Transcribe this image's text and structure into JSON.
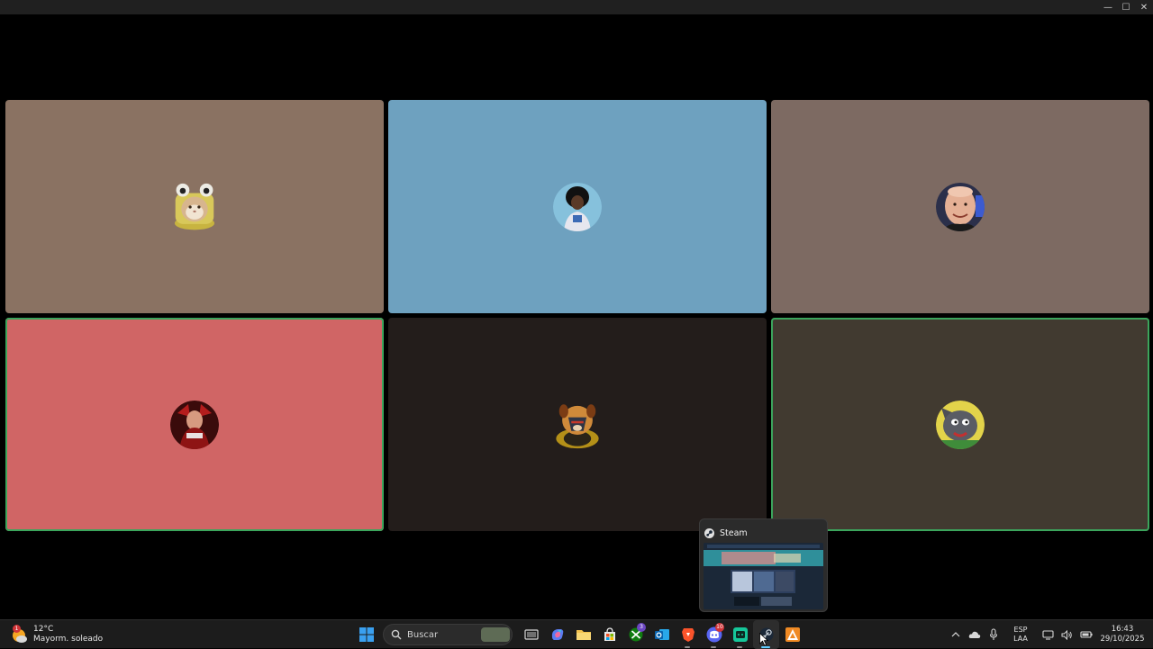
{
  "window": {
    "controls": {
      "minimize": "—",
      "maximize": "☐",
      "close": "✕"
    }
  },
  "tiles": [
    {
      "id": "user-1",
      "bg": "#8a7262",
      "speaking": false,
      "avatar": "frog-hat-cat"
    },
    {
      "id": "user-2",
      "bg": "#6ea1bf",
      "speaking": false,
      "avatar": "afro-player"
    },
    {
      "id": "user-3",
      "bg": "#7d6a62",
      "speaking": false,
      "avatar": "bald-man"
    },
    {
      "id": "user-4",
      "bg": "#d06565",
      "speaking": true,
      "avatar": "red-warrior"
    },
    {
      "id": "user-5",
      "bg": "#231d1b",
      "speaking": false,
      "avatar": "dog-knight"
    },
    {
      "id": "user-6",
      "bg": "#413a30",
      "speaking": true,
      "avatar": "grey-cat-cartoon"
    }
  ],
  "taskbar": {
    "weather": {
      "temp": "12°C",
      "condition": "Mayorm. soleado",
      "badge": "1"
    },
    "search": {
      "label": "Buscar"
    },
    "apps": [
      {
        "name": "start-button",
        "icon": "windows-logo-icon"
      },
      {
        "name": "task-view-button",
        "icon": "task-view-icon"
      },
      {
        "name": "copilot-button",
        "icon": "copilot-icon"
      },
      {
        "name": "file-explorer-button",
        "icon": "folder-icon"
      },
      {
        "name": "microsoft-store-button",
        "icon": "store-icon"
      },
      {
        "name": "xbox-button",
        "icon": "xbox-icon",
        "badge": "3"
      },
      {
        "name": "outlook-button",
        "icon": "outlook-icon"
      },
      {
        "name": "brave-button",
        "icon": "brave-icon"
      },
      {
        "name": "discord-button",
        "icon": "discord-icon",
        "badge": "10"
      },
      {
        "name": "app-green-button",
        "icon": "green-app-icon"
      },
      {
        "name": "steam-button",
        "icon": "steam-icon"
      },
      {
        "name": "app-orange-button",
        "icon": "orange-app-icon"
      }
    ],
    "language": {
      "line1": "ESP",
      "line2": "LAA"
    },
    "clock": {
      "time": "16:43",
      "date": "29/10/2025"
    }
  },
  "preview": {
    "title": "Steam"
  },
  "colors": {
    "speaking": "#3ba55c",
    "accent": "#60cdff",
    "discord": "#5865f2",
    "xbox": "#107c10"
  }
}
